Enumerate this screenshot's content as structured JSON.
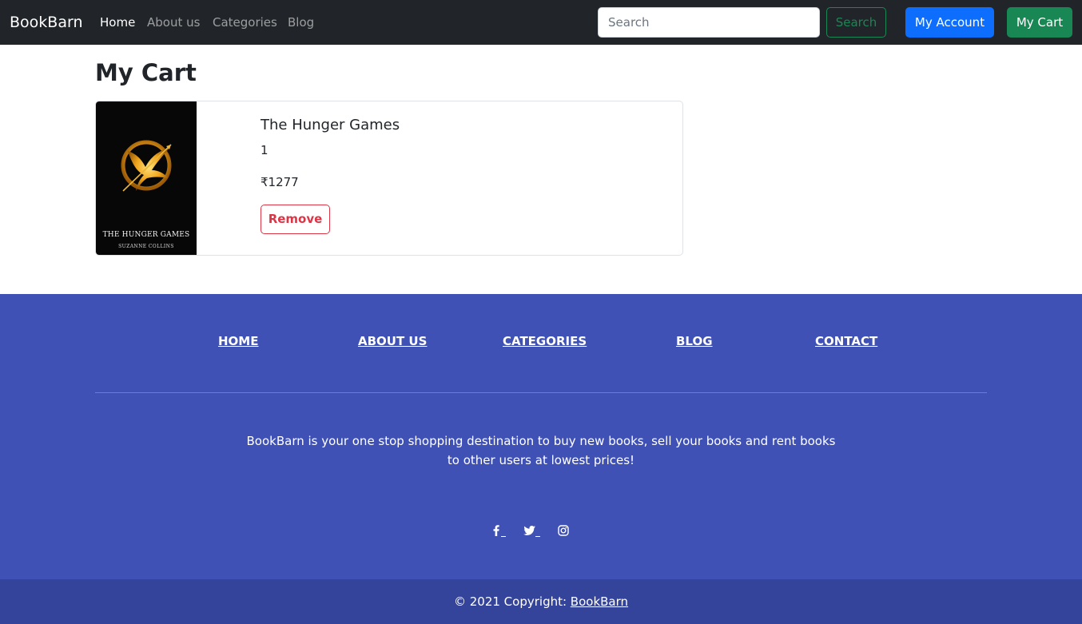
{
  "navbar": {
    "brand": "BookBarn",
    "links": [
      {
        "label": "Home",
        "active": true
      },
      {
        "label": "About us",
        "active": false
      },
      {
        "label": "Categories",
        "active": false
      },
      {
        "label": "Blog",
        "active": false
      }
    ],
    "search": {
      "placeholder": "Search",
      "value": ""
    },
    "search_button": "Search",
    "account_button": "My Account",
    "cart_button": "My Cart"
  },
  "main": {
    "title": "My Cart",
    "items": [
      {
        "title": "The Hunger Games",
        "quantity": "1",
        "price": "₹1277",
        "remove_label": "Remove",
        "cover_title": "THE HUNGER GAMES",
        "cover_author": "SUZANNE COLLINS"
      }
    ]
  },
  "footer": {
    "links": [
      "HOME",
      "ABOUT US",
      "CATEGORIES",
      "BLOG",
      "CONTACT"
    ],
    "description": "BookBarn is your one stop shopping destination to buy new books, sell your books and rent books to other users at lowest prices!",
    "social_icons": [
      "facebook-icon",
      "twitter-icon",
      "instagram-icon"
    ],
    "copyright_prefix": "© 2021 Copyright: ",
    "copyright_link": "BookBarn"
  },
  "colors": {
    "navbar_bg": "#212529",
    "primary": "#0d6efd",
    "success": "#198754",
    "danger": "#dc3545",
    "footer_bg": "#3f51b5",
    "copyright_bg": "#34449a"
  }
}
